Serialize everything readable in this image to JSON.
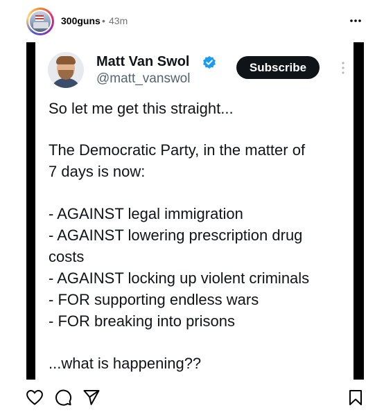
{
  "post": {
    "username": "300guns",
    "separator": "•",
    "time": "43m"
  },
  "tweet": {
    "name": "Matt Van Swol",
    "handle": "@matt_vanswol",
    "subscribe_label": "Subscribe",
    "lines": [
      "So let me get this straight...",
      "The Democratic Party, in the matter of",
      "7 days is now:",
      "- AGAINST legal immigration",
      "- AGAINST lowering prescription drug",
      "costs",
      "- AGAINST locking up violent criminals",
      "- FOR supporting endless wars",
      "- FOR breaking into prisons",
      "...what is happening??"
    ]
  },
  "icons": {
    "more": "more-horizontal-icon",
    "verified": "verified-badge-icon",
    "like": "heart-icon",
    "comment": "comment-icon",
    "share": "send-icon",
    "save": "bookmark-icon"
  },
  "colors": {
    "verified": "#1d9bf0",
    "subscribe_bg": "#0f1419",
    "handle": "#536471",
    "timestamp": "#737373"
  }
}
